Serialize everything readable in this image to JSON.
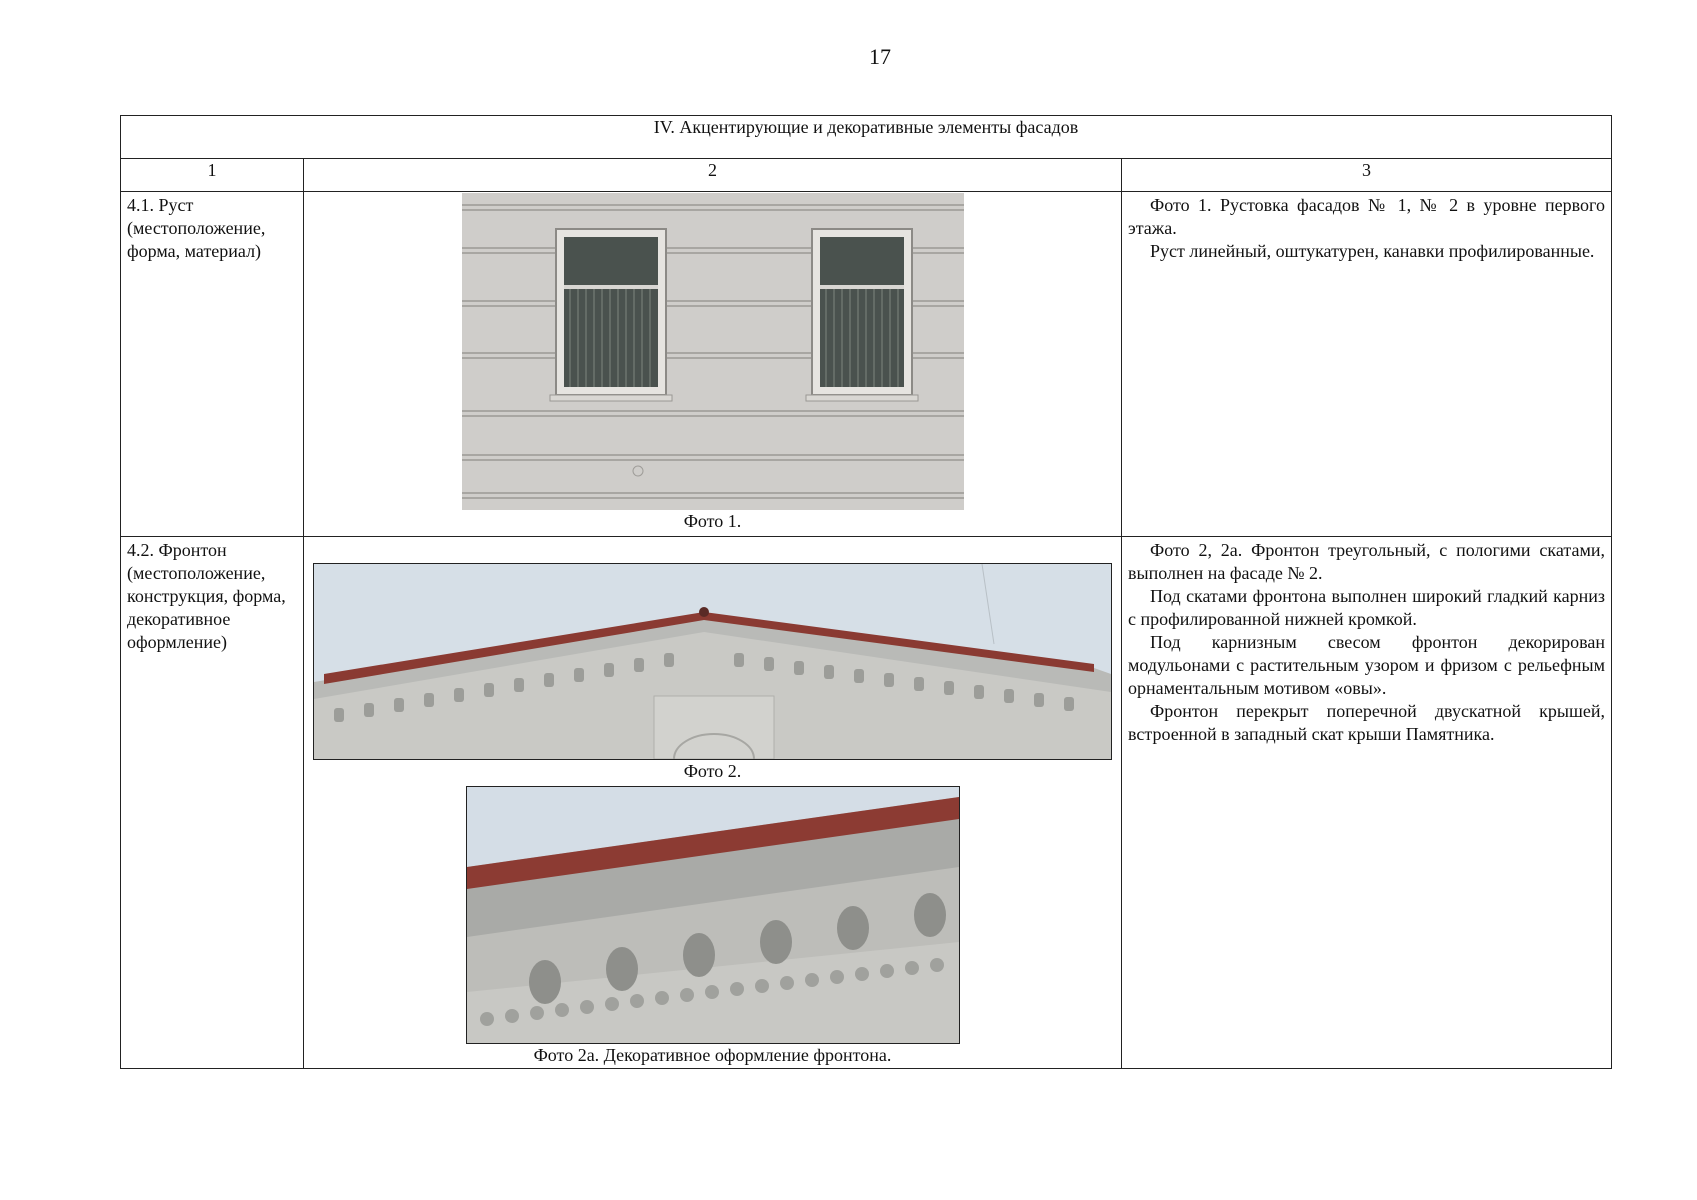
{
  "page_number": "17",
  "section_title": "IV.  Акцентирующие и декоративные элементы фасадов",
  "columns": [
    "1",
    "2",
    "3"
  ],
  "rows": [
    {
      "label": "4.1. Руст (местоположение, форма, материал)",
      "captions": [
        "Фото 1."
      ],
      "description": [
        "Фото 1. Рустовка фасадов № 1, № 2 в уровне первого этажа.",
        "Руст линейный, оштукатурен, канавки профилированные."
      ]
    },
    {
      "label": "4.2. Фронтон (местоположение, конструкция, форма, декоративное оформление)",
      "captions": [
        "Фото 2.",
        "Фото 2а. Декоративное оформление фронтона."
      ],
      "description": [
        "Фото 2, 2а. Фронтон  треугольный, с пологими скатами, выполнен на фасаде № 2.",
        "Под скатами фронтона выполнен широкий гладкий карниз с профилированной нижней кромкой.",
        "Под карнизным свесом фронтон декорирован модульонами с растительным узором и фризом с рельефным  орнаментальным мотивом «овы».",
        "Фронтон перекрыт поперечной двускатной крышей, встроенной в западный скат крыши Памятника."
      ]
    }
  ]
}
